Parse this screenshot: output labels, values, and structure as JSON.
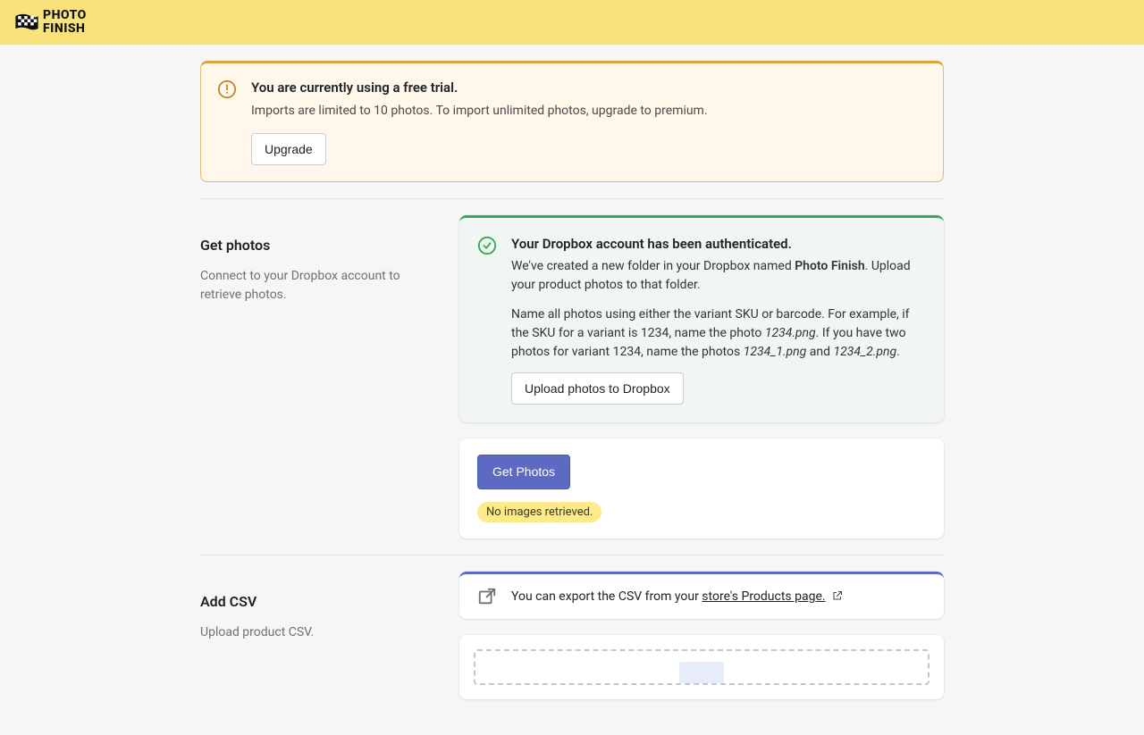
{
  "logo": {
    "top": "PHOTO",
    "bottom": "FINISH"
  },
  "trial_banner": {
    "title": "You are currently using a free trial.",
    "subtitle": "Imports are limited to 10 photos. To import unlimited photos, upgrade to premium.",
    "button": "Upgrade"
  },
  "get_photos": {
    "heading": "Get photos",
    "desc": "Connect to your Dropbox account to retrieve photos.",
    "auth_title": "Your Dropbox account has been authenticated.",
    "auth_p1_pre": "We've created a new folder in your Dropbox named ",
    "auth_p1_bold": "Photo Finish",
    "auth_p1_post": ". Upload your product photos to that folder.",
    "auth_p2_a": "Name all photos using either the variant SKU or barcode. For example, if the SKU for a variant is 1234, name the photo ",
    "auth_p2_em1": "1234.png",
    "auth_p2_b": ". If you have two photos for variant 1234, name the photos ",
    "auth_p2_em2": "1234_1.png",
    "auth_p2_c": " and ",
    "auth_p2_em3": "1234_2.png",
    "auth_p2_d": ".",
    "upload_btn": "Upload photos to Dropbox",
    "get_btn": "Get Photos",
    "badge": "No images retrieved."
  },
  "add_csv": {
    "heading": "Add CSV",
    "desc": "Upload product CSV.",
    "info_pre": "You can export the CSV from your ",
    "info_link": "store's Products page."
  }
}
